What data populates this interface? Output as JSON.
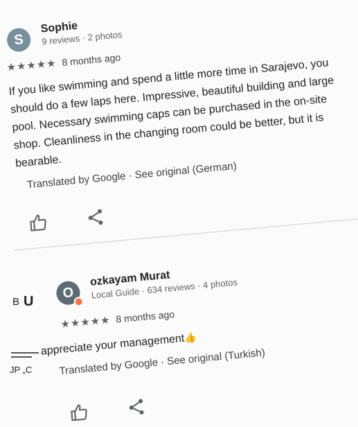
{
  "reviews": [
    {
      "avatar_letter": "S",
      "name": "Sophie",
      "meta": "9 reviews · 2 photos",
      "stars": "★★★★★",
      "when": "8 months ago",
      "text": "If you like swimming and spend a little more time in Sarajevo, you should do a few laps here. Impressive, beautiful building and large pool. Necessary swimming caps can be purchased in the on-site shop. Cleanliness in the changing room could be better, but it is bearable.",
      "translated": "Translated by Google · See original (German)"
    },
    {
      "avatar_letter": "O",
      "name": "ozkayam Murat",
      "meta": "Local Guide · 634 reviews · 4 photos",
      "stars": "★★★★★",
      "when": "8 months ago",
      "text": "appreciate your management",
      "text_emoji": "👍",
      "translated": "Translated by Google · See original (Turkish)"
    }
  ],
  "fragments": {
    "b": "B",
    "u": "U",
    "jp": "JP „C"
  },
  "icons": {
    "like": "thumbs-up-outline-icon",
    "share": "share-icon",
    "more": "more-vert-icon"
  },
  "colors": {
    "avatar_sophie": "#78909c",
    "avatar_murat": "#5d6b74",
    "local_guide_badge": "#ff7043"
  }
}
